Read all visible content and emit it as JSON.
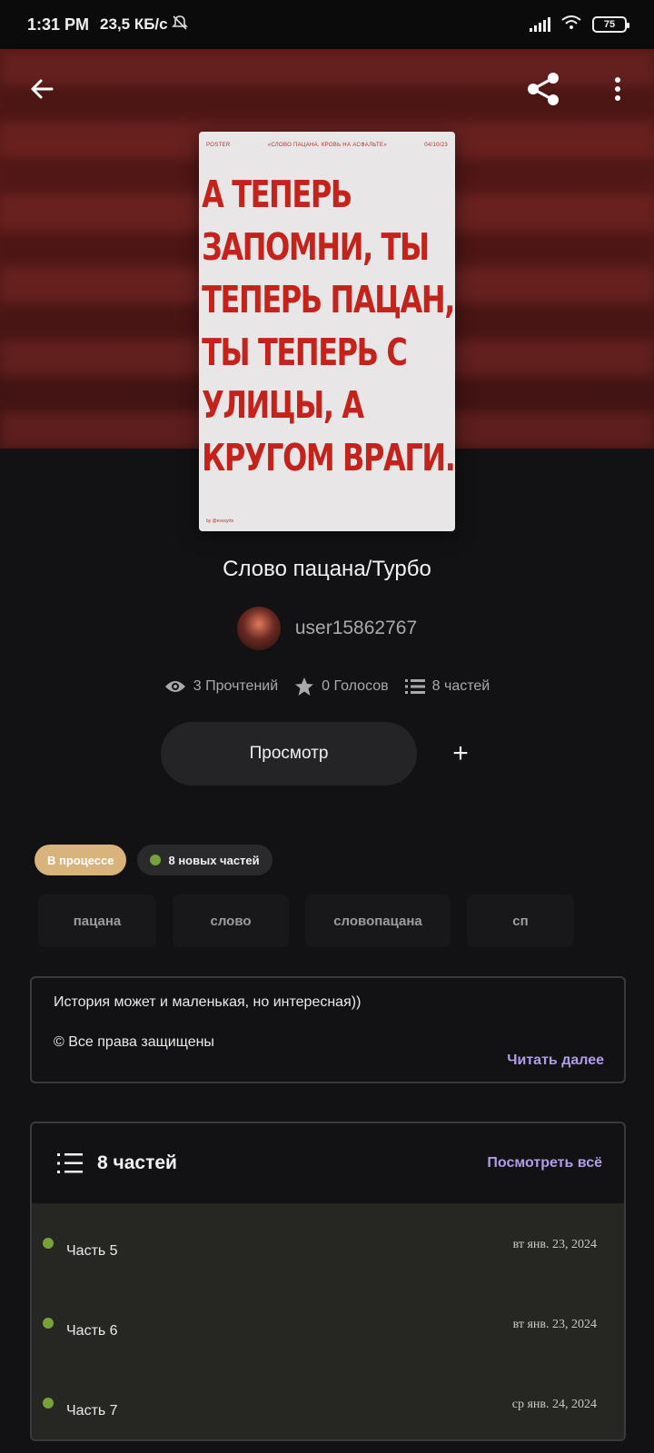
{
  "status_bar": {
    "time": "1:31 PM",
    "network_speed": "23,5 КБ/с",
    "battery": "75"
  },
  "cover": {
    "top_left": "POSTER",
    "top_center": "«СЛОВО ПАЦАНА. КРОВЬ НА АСФАЛЬТЕ»",
    "top_right": "04/10/23",
    "lines": [
      "А ТЕПЕРЬ",
      "ЗАПОМНИ, ТЫ",
      "ТЕПЕРЬ ПАЦАН,",
      "ТЫ ТЕПЕРЬ С",
      "УЛИЦЫ, А",
      "КРУГОМ ВРАГИ."
    ],
    "footer": "by @evsxyrts"
  },
  "story": {
    "title": "Слово пацана/Турбо",
    "author": "user15862767"
  },
  "stats": {
    "reads": "3 Прочтений",
    "votes": "0 Голосов",
    "parts": "8 частей"
  },
  "actions": {
    "view_label": "Просмотр",
    "add_label": "+"
  },
  "badges": {
    "status": "В процессе",
    "new_parts": "8 новых частей"
  },
  "tags": [
    "пацана",
    "слово",
    "словопацана",
    "сп"
  ],
  "description": {
    "line1": "История может и маленькая, но интересная))",
    "line2": "© Все права защищены",
    "read_more": "Читать далее"
  },
  "parts_section": {
    "title": "8 частей",
    "see_all": "Посмотреть всё",
    "items": [
      {
        "name": "Часть 5",
        "date": "вт янв. 23, 2024"
      },
      {
        "name": "Часть 6",
        "date": "вт янв. 23, 2024"
      },
      {
        "name": "Часть 7",
        "date": "ср янв. 24, 2024"
      }
    ]
  },
  "colors": {
    "accent": "#b19ce8",
    "in_progress": "#d8b37c",
    "new_dot": "#77a13a",
    "cover_text": "#c4231c"
  }
}
